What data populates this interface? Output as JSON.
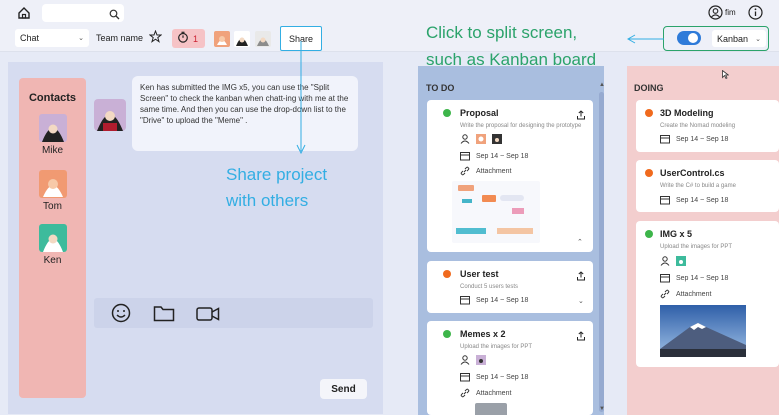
{
  "toolbar": {
    "chat_select": "Chat",
    "team_name": "Team name",
    "timer_count": "1",
    "share_label": "Share",
    "view_select": "Kanban"
  },
  "topbar": {
    "user_name": "fim"
  },
  "callouts": {
    "split_line1": "Click to split screen,",
    "split_line2": "such as Kanban board",
    "share_line1": "Share project",
    "share_line2": "with others"
  },
  "chat": {
    "contacts_title": "Contacts",
    "contacts": [
      {
        "name": "Mike"
      },
      {
        "name": "Tom"
      },
      {
        "name": "Ken"
      }
    ],
    "message": "Ken has submitted the IMG x5, you can use the \"Split Screen\"  to check the kanban when chatt-ing with me at the same time. And then you can use the drop-down list to the \"Drive\" to  upload the \"Meme\" .",
    "send_label": "Send"
  },
  "kanban": {
    "columns": [
      {
        "title": "TO DO",
        "cards": [
          {
            "title": "Proposal",
            "desc": "Write the proposal for designing the prototype",
            "dates": "Sep 14 ~ Sep 18",
            "attachment": "Attachment",
            "status_color": "#3db54a"
          },
          {
            "title": "User test",
            "desc": "Conduct 5 users tests",
            "dates": "Sep 14 ~ Sep 18",
            "status_color": "#f06a1e"
          },
          {
            "title": "Memes x 2",
            "desc": "Upload the images for PPT",
            "dates": "Sep 14 ~ Sep 18",
            "attachment": "Attachment",
            "status_color": "#3db54a"
          }
        ]
      },
      {
        "title": "DOING",
        "cards": [
          {
            "title": "3D Modeling",
            "desc": "Create the Nomad modeling",
            "dates": "Sep 14 ~ Sep 18",
            "status_color": "#f06a1e"
          },
          {
            "title": "UserControl.cs",
            "desc": "Write the C# to build a game",
            "dates": "Sep 14 ~ Sep 18",
            "status_color": "#f06a1e"
          },
          {
            "title": "IMG x 5",
            "desc": "Upload the images for PPT",
            "dates": "Sep 14 ~ Sep 18",
            "attachment": "Attachment",
            "status_color": "#3db54a"
          }
        ]
      }
    ]
  },
  "colors": {
    "accent_blue": "#33aee3",
    "accent_green": "#2ba36b",
    "toggle": "#2f7bd9",
    "todo_bg": "#a9bedf",
    "doing_bg": "#f3cece",
    "contacts_bg": "#f0b6b3"
  }
}
